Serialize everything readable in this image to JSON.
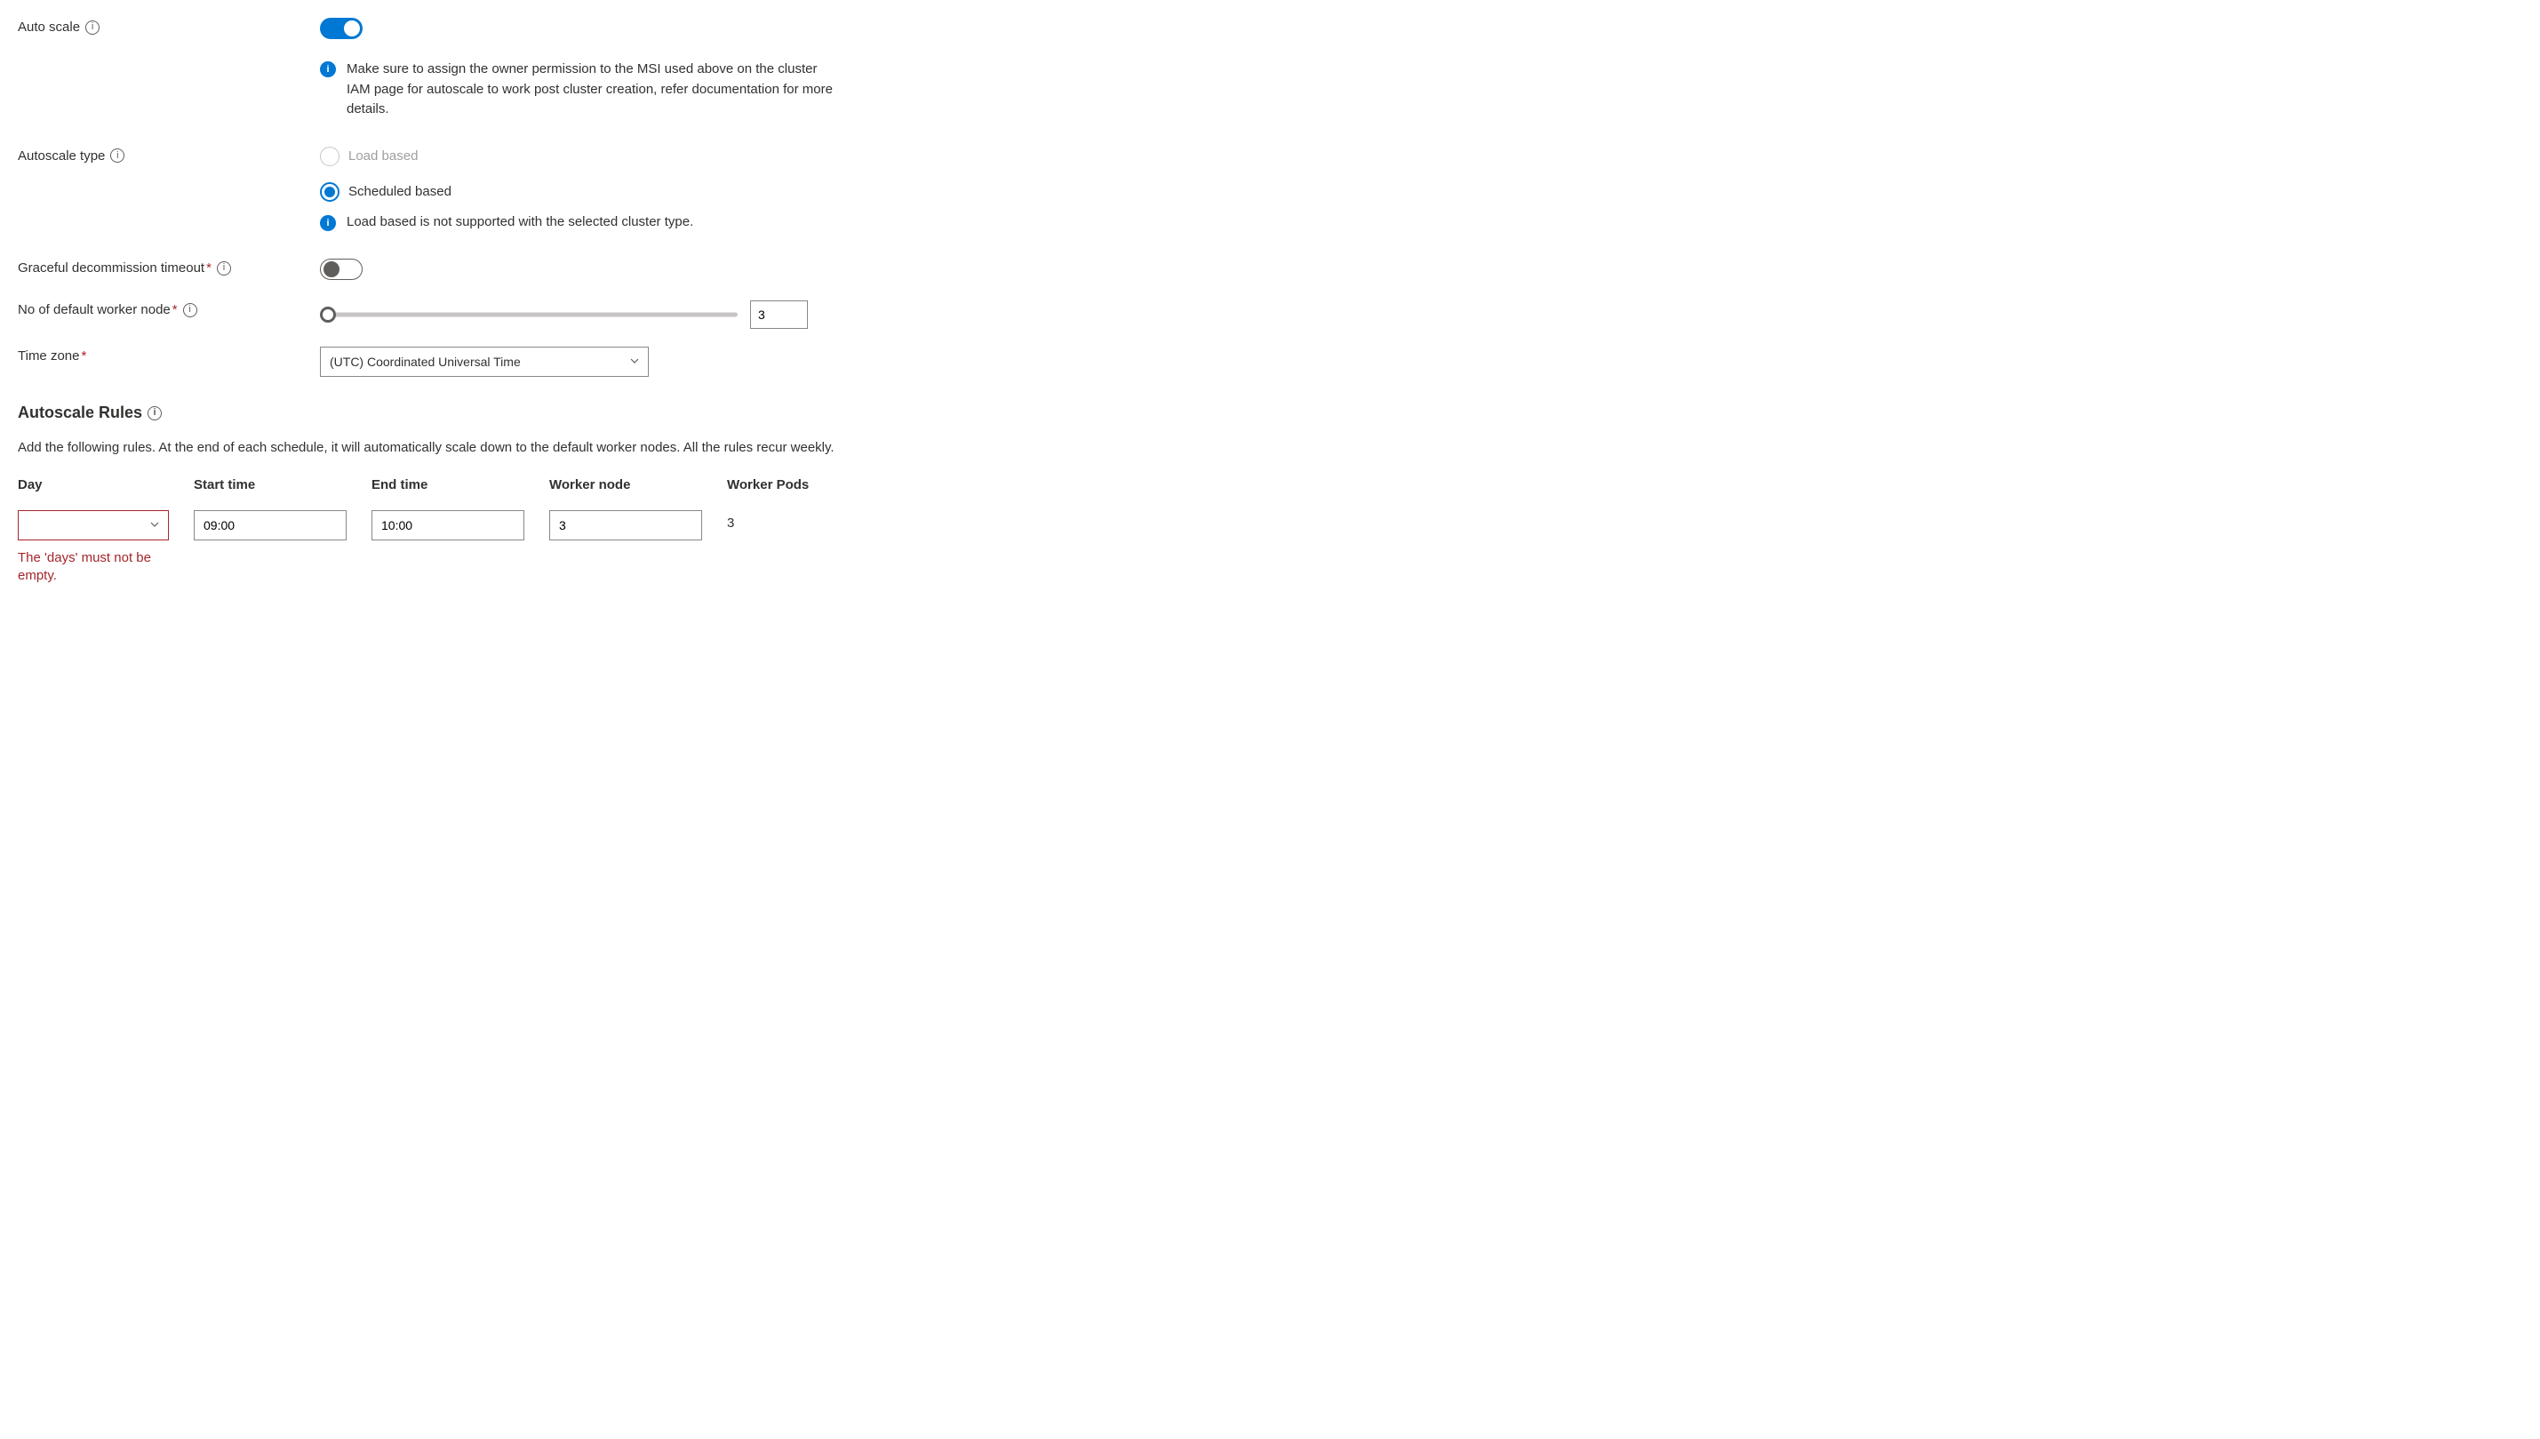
{
  "autoScale": {
    "label": "Auto scale",
    "enabled": true,
    "infoMessage": "Make sure to assign the owner permission to the MSI used above on the cluster IAM page for autoscale to work post cluster creation, refer documentation for more details."
  },
  "autoscaleType": {
    "label": "Autoscale type",
    "options": {
      "loadBased": "Load based",
      "scheduledBased": "Scheduled based"
    },
    "selected": "scheduledBased",
    "warning": "Load based is not supported with the selected cluster type."
  },
  "gracefulDecommission": {
    "label": "Graceful decommission timeout",
    "enabled": false
  },
  "defaultWorkerNode": {
    "label": "No of default worker node",
    "value": "3"
  },
  "timeZone": {
    "label": "Time zone",
    "value": "(UTC) Coordinated Universal Time"
  },
  "rulesSection": {
    "heading": "Autoscale Rules",
    "description": "Add the following rules. At the end of each schedule, it will automatically scale down to the default worker nodes. All the rules recur weekly."
  },
  "rulesTable": {
    "headers": {
      "day": "Day",
      "startTime": "Start time",
      "endTime": "End time",
      "workerNode": "Worker node",
      "workerPods": "Worker Pods"
    },
    "row": {
      "day": "",
      "startTime": "09:00",
      "endTime": "10:00",
      "workerNode": "3",
      "workerPods": "3"
    },
    "dayError": "The 'days' must not be empty."
  }
}
